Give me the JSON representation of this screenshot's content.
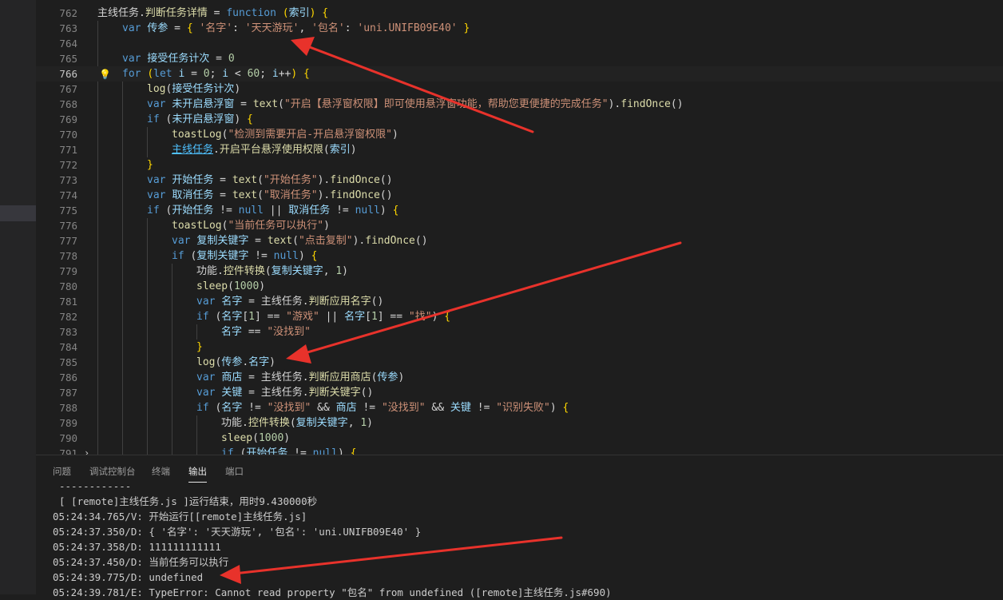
{
  "editor": {
    "lines": [
      {
        "num": "762",
        "indent": 0,
        "html": "主线任务.<span class=\"f\">判断任务详情</span> = <span class=\"k\">function</span> <span class=\"p\">(</span><span class=\"v\">索引</span><span class=\"p\">)</span> <span class=\"p\">{</span>"
      },
      {
        "num": "763",
        "indent": 1,
        "html": "<span class=\"k\">var</span> <span class=\"v\">传参</span> = <span class=\"p\">{</span> <span class=\"s\">'名字'</span>: <span class=\"s\">'天天游玩'</span>, <span class=\"s\">'包名'</span>: <span class=\"s\">'uni.UNIFB09E40'</span> <span class=\"p\">}</span>"
      },
      {
        "num": "764",
        "indent": 0,
        "html": ""
      },
      {
        "num": "765",
        "indent": 1,
        "html": "<span class=\"k\">var</span> <span class=\"v\">接受任务计次</span> = <span class=\"n\">0</span>"
      },
      {
        "num": "766",
        "indent": 1,
        "current": true,
        "bulb": true,
        "html": "<span class=\"k\">for</span> <span class=\"p\">(</span><span class=\"k\">let</span> <span class=\"v\">i</span> = <span class=\"n\">0</span>; <span class=\"v\">i</span> &lt; <span class=\"n\">60</span>; <span class=\"v\">i</span>++<span class=\"p\">)</span> <span class=\"p\">{</span>"
      },
      {
        "num": "767",
        "indent": 2,
        "html": "<span class=\"f\">log</span>(<span class=\"v\">接受任务计次</span>)"
      },
      {
        "num": "768",
        "indent": 2,
        "html": "<span class=\"k\">var</span> <span class=\"v\">未开启悬浮窗</span> = <span class=\"f\">text</span>(<span class=\"s\">\"开启【悬浮窗权限】即可使用悬浮窗功能，帮助您更便捷的完成任务\"</span>).<span class=\"f\">findOnce</span>()"
      },
      {
        "num": "769",
        "indent": 2,
        "html": "<span class=\"k\">if</span> (<span class=\"v\">未开启悬浮窗</span>) <span class=\"p\">{</span>"
      },
      {
        "num": "770",
        "indent": 3,
        "html": "<span class=\"f\">toastLog</span>(<span class=\"s\">\"检测到需要开启-开启悬浮窗权限\"</span>)"
      },
      {
        "num": "771",
        "indent": 3,
        "html": "<span class=\"l\">主线任务</span>.<span class=\"f\">开启平台悬浮使用权限</span>(<span class=\"v\">索引</span>)"
      },
      {
        "num": "772",
        "indent": 2,
        "html": "<span class=\"p\">}</span>"
      },
      {
        "num": "773",
        "indent": 2,
        "html": "<span class=\"k\">var</span> <span class=\"v\">开始任务</span> = <span class=\"f\">text</span>(<span class=\"s\">\"开始任务\"</span>).<span class=\"f\">findOnce</span>()"
      },
      {
        "num": "774",
        "indent": 2,
        "html": "<span class=\"k\">var</span> <span class=\"v\">取消任务</span> = <span class=\"f\">text</span>(<span class=\"s\">\"取消任务\"</span>).<span class=\"f\">findOnce</span>()"
      },
      {
        "num": "775",
        "indent": 2,
        "html": "<span class=\"k\">if</span> (<span class=\"v\">开始任务</span> != <span class=\"k\">null</span> || <span class=\"v\">取消任务</span> != <span class=\"k\">null</span>) <span class=\"p\">{</span>"
      },
      {
        "num": "776",
        "indent": 3,
        "html": "<span class=\"f\">toastLog</span>(<span class=\"s\">\"当前任务可以执行\"</span>)"
      },
      {
        "num": "777",
        "indent": 3,
        "html": "<span class=\"k\">var</span> <span class=\"v\">复制关键字</span> = <span class=\"f\">text</span>(<span class=\"s\">\"点击复制\"</span>).<span class=\"f\">findOnce</span>()"
      },
      {
        "num": "778",
        "indent": 3,
        "html": "<span class=\"k\">if</span> (<span class=\"v\">复制关键字</span> != <span class=\"k\">null</span>) <span class=\"p\">{</span>"
      },
      {
        "num": "779",
        "indent": 4,
        "html": "功能.<span class=\"f\">控件转换</span>(<span class=\"v\">复制关键字</span>, <span class=\"n\">1</span>)"
      },
      {
        "num": "780",
        "indent": 4,
        "html": "<span class=\"f\">sleep</span>(<span class=\"n\">1000</span>)"
      },
      {
        "num": "781",
        "indent": 4,
        "html": "<span class=\"k\">var</span> <span class=\"v\">名字</span> = 主线任务.<span class=\"f\">判断应用名字</span>()"
      },
      {
        "num": "782",
        "indent": 4,
        "html": "<span class=\"k\">if</span> (<span class=\"v\">名字</span>[<span class=\"n\">1</span>] == <span class=\"s\">\"游戏\"</span> || <span class=\"v\">名字</span>[<span class=\"n\">1</span>] == <span class=\"s\">\"找\"</span>) <span class=\"p\">{</span>"
      },
      {
        "num": "783",
        "indent": 5,
        "html": "<span class=\"v\">名字</span> == <span class=\"s\">\"没找到\"</span>"
      },
      {
        "num": "784",
        "indent": 4,
        "html": "<span class=\"p\">}</span>"
      },
      {
        "num": "785",
        "indent": 4,
        "html": "<span class=\"f\">log</span>(<span class=\"v\">传参</span>.<span class=\"v\">名字</span>)"
      },
      {
        "num": "786",
        "indent": 4,
        "html": "<span class=\"k\">var</span> <span class=\"v\">商店</span> = 主线任务.<span class=\"f\">判断应用商店</span>(<span class=\"v\">传参</span>)"
      },
      {
        "num": "787",
        "indent": 4,
        "html": "<span class=\"k\">var</span> <span class=\"v\">关键</span> = 主线任务.<span class=\"f\">判断关键字</span>()"
      },
      {
        "num": "788",
        "indent": 4,
        "html": "<span class=\"k\">if</span> (<span class=\"v\">名字</span> != <span class=\"s\">\"没找到\"</span> &amp;&amp; <span class=\"v\">商店</span> != <span class=\"s\">\"没找到\"</span> &amp;&amp; <span class=\"v\">关键</span> != <span class=\"s\">\"识别失败\"</span>) <span class=\"p\">{</span>"
      },
      {
        "num": "789",
        "indent": 5,
        "html": "功能.<span class=\"f\">控件转换</span>(<span class=\"v\">复制关键字</span>, <span class=\"n\">1</span>)"
      },
      {
        "num": "790",
        "indent": 5,
        "html": "<span class=\"f\">sleep</span>(<span class=\"n\">1000</span>)"
      },
      {
        "num": "791",
        "indent": 5,
        "fold": true,
        "html": "<span class=\"k\">if</span> (<span class=\"v\">开始任务</span> != <span class=\"k\">null</span>) <span class=\"p\">{</span>…"
      }
    ]
  },
  "panel": {
    "tabs": [
      "问题",
      "调试控制台",
      "终端",
      "输出",
      "端口"
    ],
    "active_tab": "输出",
    "output": [
      "------------",
      "[ [remote]主线任务.js ]运行结束，用时9.430000秒",
      "05:24:34.765/V: 开始运行[[remote]主线任务.js]",
      "05:24:37.350/D: { '名字': '天天游玩', '包名': 'uni.UNIFB09E40' }",
      "05:24:37.358/D: 111111111111",
      "05:24:37.450/D: 当前任务可以执行",
      "05:24:39.775/D: undefined",
      "05:24:39.781/E: TypeError: Cannot read property \"包名\" from undefined ([remote]主线任务.js#690)"
    ]
  },
  "colors": {
    "annotation_arrow": "#e8322b",
    "keyword": "#569cd6",
    "string": "#ce9178",
    "function": "#dcdcaa",
    "variable": "#9cdcfe",
    "number": "#b5cea8"
  },
  "icons": [
    "lightbulb-icon",
    "chevron-right-icon"
  ]
}
